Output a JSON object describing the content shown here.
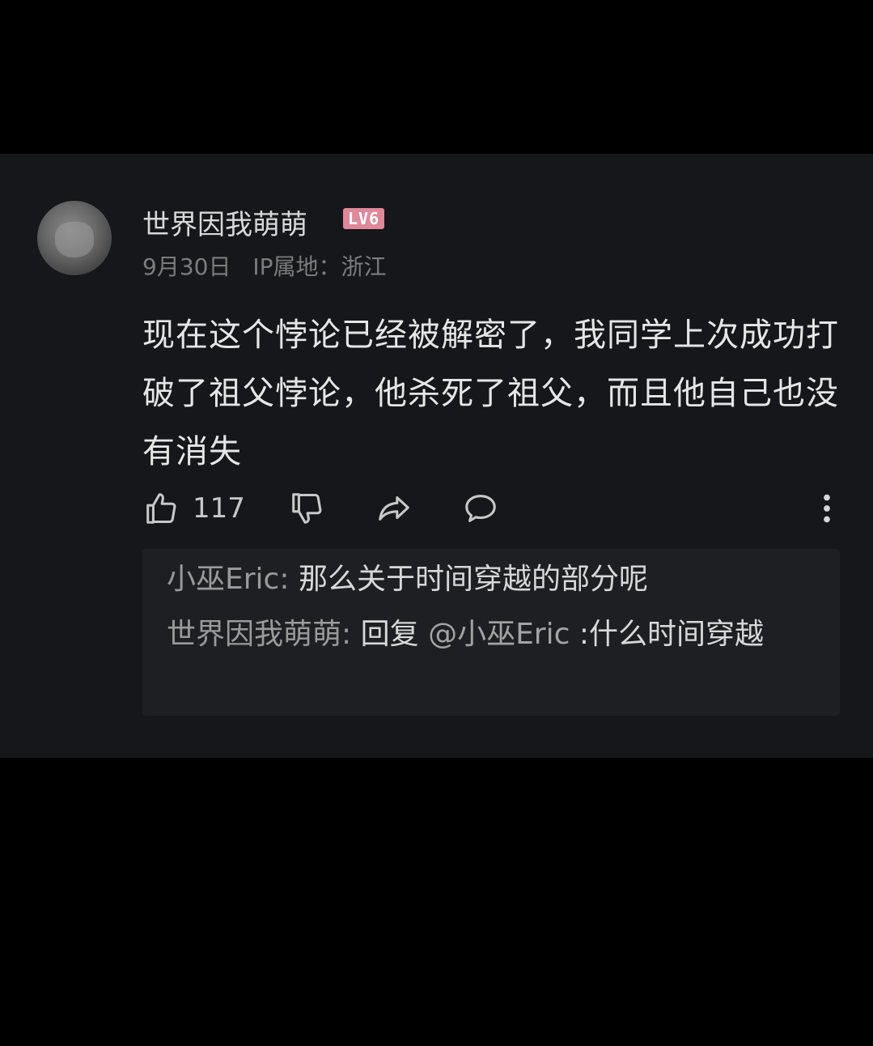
{
  "comment": {
    "username": "世界因我萌萌",
    "level_badge": "LV6",
    "date": "9月30日",
    "ip_location": "IP属地：浙江",
    "text": "现在这个悖论已经被解密了，我同学上次成功打破了祖父悖论，他杀死了祖父，而且他自己也没有消失",
    "likes": "117"
  },
  "icons": {
    "like": "thumbs-up-icon",
    "dislike": "thumbs-down-icon",
    "share": "share-icon",
    "reply": "comment-bubble-icon",
    "more": "more-vertical-icon"
  },
  "replies": [
    {
      "author": "小巫Eric:",
      "text": "那么关于时间穿越的部分呢"
    },
    {
      "author": "世界因我萌萌:",
      "reply_prefix": "回复",
      "mention": "@小巫Eric",
      "text": ":什么时间穿越"
    }
  ],
  "colors": {
    "background": "#000000",
    "card": "#15171a",
    "reply_box": "#1d1f22",
    "badge": "#e0889a"
  }
}
